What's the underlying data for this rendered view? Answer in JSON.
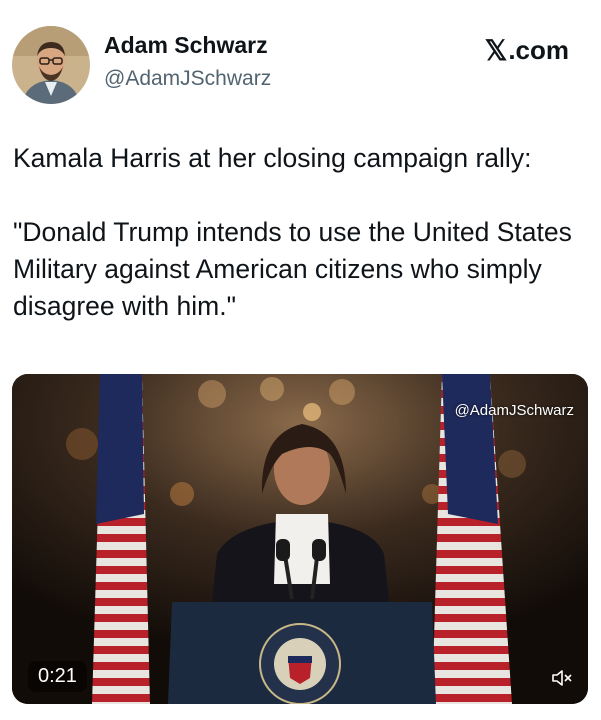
{
  "author": {
    "name": "Adam Schwarz",
    "handle": "@AdamJSchwarz"
  },
  "source": {
    "logo_icon": "x-logo-icon",
    "domain_text": ".com"
  },
  "tweet": {
    "line1": "Kamala Harris at her closing campaign rally:",
    "quote": "\"Donald Trump intends to use the United States Military against American citizens who simply disagree with him.\""
  },
  "video": {
    "watermark": "@AdamJSchwarz",
    "duration": "0:21",
    "mute_icon": "speaker-muted-icon",
    "seal_text": "PRESIDENT OF THE UNITED STATES"
  }
}
